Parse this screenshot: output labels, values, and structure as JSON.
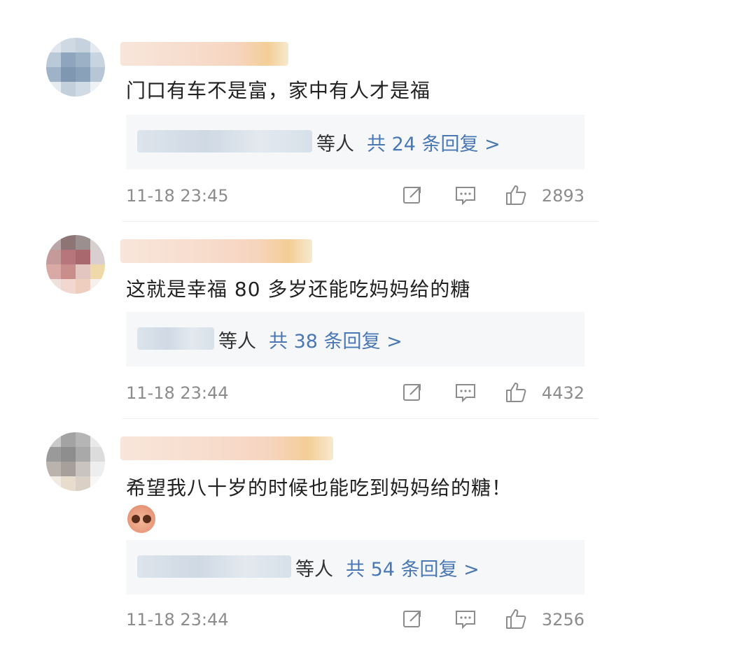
{
  "comments": [
    {
      "text": "门口有车不是富，家中有人才是福",
      "reply_suffix": "等人",
      "reply_count_label": "共 24 条回复 >",
      "time": "11-18 23:45",
      "likes": "2893",
      "avatar_colors": [
        "#dfe6ee",
        "#cfd9e4",
        "#c6d2de",
        "#e3e9ef",
        "#b9c9d8",
        "#8ea5bd",
        "#9db1c6",
        "#c8d4df",
        "#9fb3c8",
        "#7f97b1",
        "#8aa1ba",
        "#b7c6d5",
        "#e5ebf0",
        "#c3cfdb",
        "#d1dbe5",
        "#eef2f5"
      ]
    },
    {
      "text": "这就是幸福 80 多岁还能吃妈妈给的糖",
      "reply_suffix": "等人",
      "reply_count_label": "共 38 条回复 >",
      "time": "11-18 23:44",
      "likes": "4432",
      "avatar_colors": [
        "#b9a6a6",
        "#8d7575",
        "#9c8f8f",
        "#d7d0d0",
        "#c49a9b",
        "#b5777c",
        "#a9686e",
        "#d9cfd0",
        "#d8a9a5",
        "#c98d8b",
        "#e4c6c0",
        "#f0d9a8",
        "#efe2dd",
        "#f1d7cf",
        "#eecfbf",
        "#f7f1ee"
      ]
    },
    {
      "text": "希望我八十岁的时候也能吃到妈妈给的糖！",
      "reply_suffix": "等人",
      "reply_count_label": "共 54 条回复 >",
      "time": "11-18 23:44",
      "likes": "3256",
      "avatar_colors": [
        "#c9c9c9",
        "#a3a3a3",
        "#b5b5b5",
        "#e9e9e9",
        "#9a9a9a",
        "#8e8e8e",
        "#a9a9a9",
        "#dcdcdc",
        "#b9b2ad",
        "#a7a09a",
        "#c9c4c0",
        "#eeeeee",
        "#f1ebe4",
        "#e8dccf",
        "#dad0c5",
        "#f7f7f7"
      ]
    }
  ],
  "icons": {
    "share": "share-icon",
    "comment": "comment-icon",
    "like": "thumbs-up-icon"
  },
  "colors": {
    "reply_link": "#4a78b4",
    "meta_gray": "#8c8c8c",
    "reply_bg": "#f6f7f9"
  }
}
